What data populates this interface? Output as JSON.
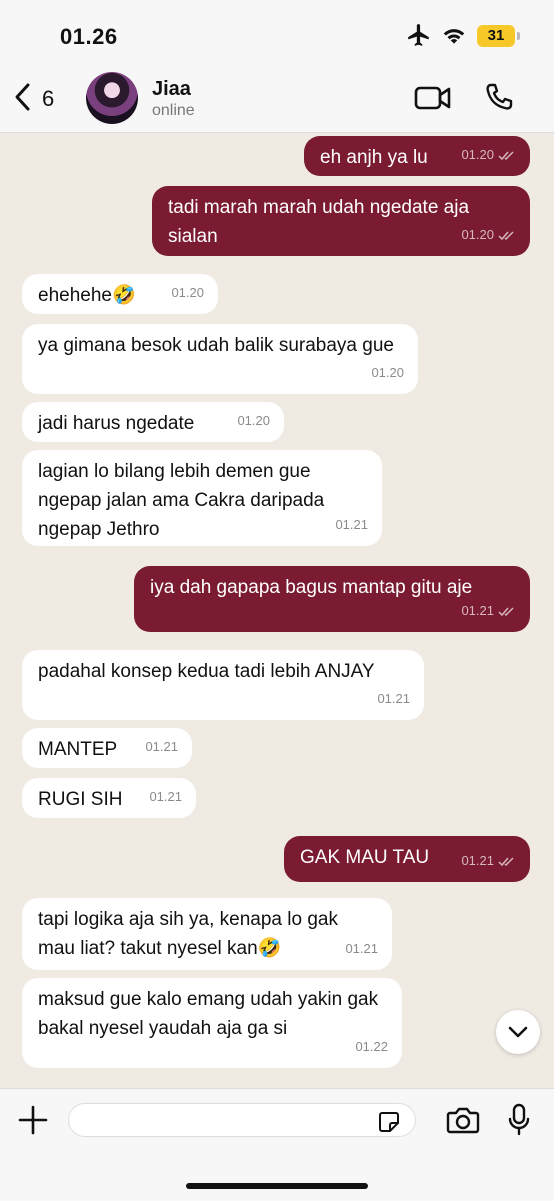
{
  "status": {
    "time": "01.26",
    "battery": "31",
    "icons": [
      "airplane-icon",
      "wifi-icon",
      "battery-icon"
    ]
  },
  "header": {
    "back_count": "6",
    "name": "Jiaa",
    "presence": "online"
  },
  "messages": [
    {
      "dir": "out",
      "text": "eh anjh ya lu",
      "time": "01.20"
    },
    {
      "dir": "out",
      "text": "tadi marah marah udah ngedate aja sialan",
      "time": "01.20"
    },
    {
      "dir": "in",
      "text": "ehehehe🤣",
      "time": "01.20"
    },
    {
      "dir": "in",
      "text": "ya gimana besok udah balik surabaya gue",
      "time": "01.20"
    },
    {
      "dir": "in",
      "text": "jadi harus ngedate",
      "time": "01.20"
    },
    {
      "dir": "in",
      "text": "lagian lo bilang lebih demen gue ngepap jalan ama Cakra daripada ngepap Jethro",
      "time": "01.21"
    },
    {
      "dir": "out",
      "text": "iya dah gapapa bagus mantap gitu aje",
      "time": "01.21"
    },
    {
      "dir": "in",
      "text": "padahal konsep kedua tadi lebih ANJAY",
      "time": "01.21"
    },
    {
      "dir": "in",
      "text": "MANTEP",
      "time": "01.21"
    },
    {
      "dir": "in",
      "text": "RUGI SIH",
      "time": "01.21"
    },
    {
      "dir": "out",
      "text": "GAK MAU TAU",
      "time": "01.21"
    },
    {
      "dir": "in",
      "text": "tapi logika aja sih ya, kenapa lo gak mau liat? takut nyesel kan🤣",
      "time": "01.21"
    },
    {
      "dir": "in",
      "text": "maksud gue kalo emang udah yakin gak bakal nyesel yaudah aja ga si",
      "time": "01.22"
    }
  ],
  "colors": {
    "outgoing": "#7a1b32",
    "incoming": "#ffffff",
    "background": "#efeae2",
    "battery": "#f6c928"
  }
}
